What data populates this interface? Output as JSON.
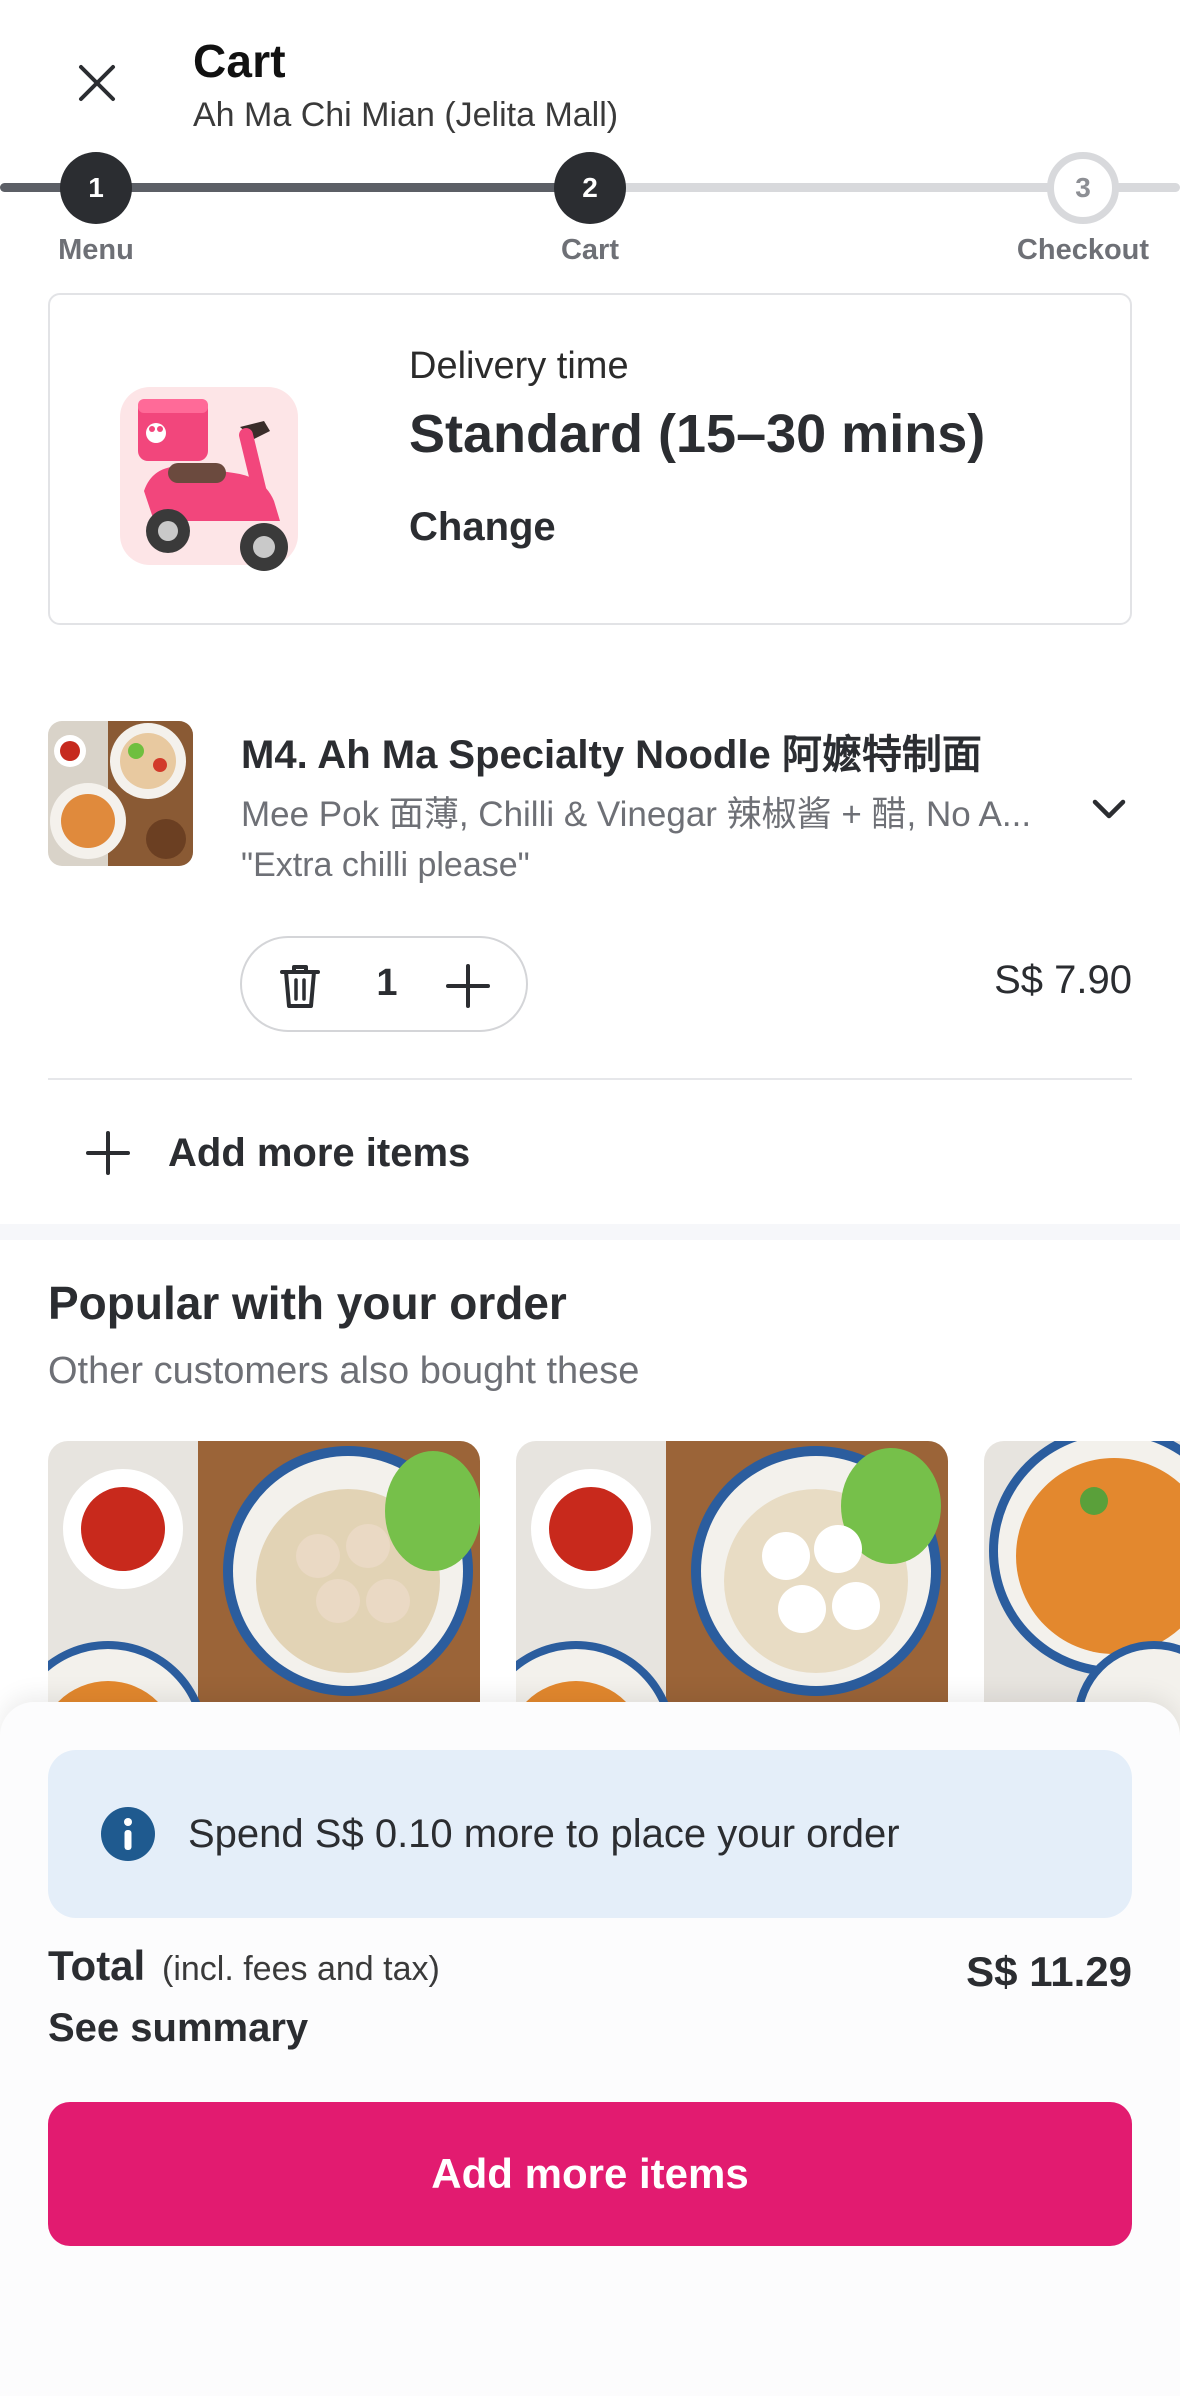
{
  "header": {
    "title": "Cart",
    "subtitle": "Ah Ma Chi Mian (Jelita Mall)",
    "close_icon": "close-icon"
  },
  "stepper": {
    "steps": [
      {
        "number": "1",
        "label": "Menu",
        "state": "done"
      },
      {
        "number": "2",
        "label": "Cart",
        "state": "done"
      },
      {
        "number": "3",
        "label": "Checkout",
        "state": "todo"
      }
    ]
  },
  "delivery": {
    "label": "Delivery time",
    "value": "Standard (15–30 mins)",
    "change_label": "Change",
    "icon": "scooter-icon"
  },
  "cart_item": {
    "name": "M4. Ah Ma Specialty Noodle 阿嬷特制面",
    "options": "Mee Pok 面薄, Chilli & Vinegar 辣椒酱 + 醋, No A...",
    "note": "\"Extra chilli please\"",
    "quantity": "1",
    "price": "S$ 7.90"
  },
  "add_more_link": {
    "label": "Add more items"
  },
  "popular": {
    "title": "Popular with your order",
    "subtitle": "Other customers also bought these"
  },
  "bottom_sheet": {
    "info_text": "Spend S$ 0.10 more to place your order",
    "total_label": "Total",
    "total_note": "(incl. fees and tax)",
    "total_value": "S$ 11.29",
    "see_summary": "See summary",
    "cta_label": "Add more items"
  },
  "colors": {
    "brand": "#e21b70",
    "info_bg": "#e4eef9",
    "info_icon": "#1f5a8f",
    "stepper_done": "#2b2d31",
    "stepper_todo": "#d8d9dc"
  }
}
